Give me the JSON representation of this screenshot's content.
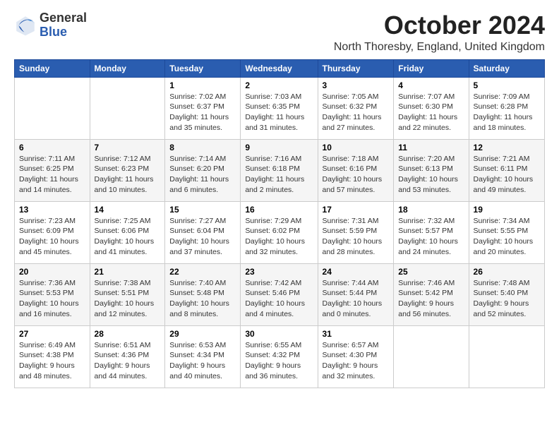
{
  "logo": {
    "general": "General",
    "blue": "Blue"
  },
  "title": "October 2024",
  "location": "North Thoresby, England, United Kingdom",
  "weekdays": [
    "Sunday",
    "Monday",
    "Tuesday",
    "Wednesday",
    "Thursday",
    "Friday",
    "Saturday"
  ],
  "weeks": [
    [
      {
        "day": "",
        "sunrise": "",
        "sunset": "",
        "daylight": ""
      },
      {
        "day": "",
        "sunrise": "",
        "sunset": "",
        "daylight": ""
      },
      {
        "day": "1",
        "sunrise": "Sunrise: 7:02 AM",
        "sunset": "Sunset: 6:37 PM",
        "daylight": "Daylight: 11 hours and 35 minutes."
      },
      {
        "day": "2",
        "sunrise": "Sunrise: 7:03 AM",
        "sunset": "Sunset: 6:35 PM",
        "daylight": "Daylight: 11 hours and 31 minutes."
      },
      {
        "day": "3",
        "sunrise": "Sunrise: 7:05 AM",
        "sunset": "Sunset: 6:32 PM",
        "daylight": "Daylight: 11 hours and 27 minutes."
      },
      {
        "day": "4",
        "sunrise": "Sunrise: 7:07 AM",
        "sunset": "Sunset: 6:30 PM",
        "daylight": "Daylight: 11 hours and 22 minutes."
      },
      {
        "day": "5",
        "sunrise": "Sunrise: 7:09 AM",
        "sunset": "Sunset: 6:28 PM",
        "daylight": "Daylight: 11 hours and 18 minutes."
      }
    ],
    [
      {
        "day": "6",
        "sunrise": "Sunrise: 7:11 AM",
        "sunset": "Sunset: 6:25 PM",
        "daylight": "Daylight: 11 hours and 14 minutes."
      },
      {
        "day": "7",
        "sunrise": "Sunrise: 7:12 AM",
        "sunset": "Sunset: 6:23 PM",
        "daylight": "Daylight: 11 hours and 10 minutes."
      },
      {
        "day": "8",
        "sunrise": "Sunrise: 7:14 AM",
        "sunset": "Sunset: 6:20 PM",
        "daylight": "Daylight: 11 hours and 6 minutes."
      },
      {
        "day": "9",
        "sunrise": "Sunrise: 7:16 AM",
        "sunset": "Sunset: 6:18 PM",
        "daylight": "Daylight: 11 hours and 2 minutes."
      },
      {
        "day": "10",
        "sunrise": "Sunrise: 7:18 AM",
        "sunset": "Sunset: 6:16 PM",
        "daylight": "Daylight: 10 hours and 57 minutes."
      },
      {
        "day": "11",
        "sunrise": "Sunrise: 7:20 AM",
        "sunset": "Sunset: 6:13 PM",
        "daylight": "Daylight: 10 hours and 53 minutes."
      },
      {
        "day": "12",
        "sunrise": "Sunrise: 7:21 AM",
        "sunset": "Sunset: 6:11 PM",
        "daylight": "Daylight: 10 hours and 49 minutes."
      }
    ],
    [
      {
        "day": "13",
        "sunrise": "Sunrise: 7:23 AM",
        "sunset": "Sunset: 6:09 PM",
        "daylight": "Daylight: 10 hours and 45 minutes."
      },
      {
        "day": "14",
        "sunrise": "Sunrise: 7:25 AM",
        "sunset": "Sunset: 6:06 PM",
        "daylight": "Daylight: 10 hours and 41 minutes."
      },
      {
        "day": "15",
        "sunrise": "Sunrise: 7:27 AM",
        "sunset": "Sunset: 6:04 PM",
        "daylight": "Daylight: 10 hours and 37 minutes."
      },
      {
        "day": "16",
        "sunrise": "Sunrise: 7:29 AM",
        "sunset": "Sunset: 6:02 PM",
        "daylight": "Daylight: 10 hours and 32 minutes."
      },
      {
        "day": "17",
        "sunrise": "Sunrise: 7:31 AM",
        "sunset": "Sunset: 5:59 PM",
        "daylight": "Daylight: 10 hours and 28 minutes."
      },
      {
        "day": "18",
        "sunrise": "Sunrise: 7:32 AM",
        "sunset": "Sunset: 5:57 PM",
        "daylight": "Daylight: 10 hours and 24 minutes."
      },
      {
        "day": "19",
        "sunrise": "Sunrise: 7:34 AM",
        "sunset": "Sunset: 5:55 PM",
        "daylight": "Daylight: 10 hours and 20 minutes."
      }
    ],
    [
      {
        "day": "20",
        "sunrise": "Sunrise: 7:36 AM",
        "sunset": "Sunset: 5:53 PM",
        "daylight": "Daylight: 10 hours and 16 minutes."
      },
      {
        "day": "21",
        "sunrise": "Sunrise: 7:38 AM",
        "sunset": "Sunset: 5:51 PM",
        "daylight": "Daylight: 10 hours and 12 minutes."
      },
      {
        "day": "22",
        "sunrise": "Sunrise: 7:40 AM",
        "sunset": "Sunset: 5:48 PM",
        "daylight": "Daylight: 10 hours and 8 minutes."
      },
      {
        "day": "23",
        "sunrise": "Sunrise: 7:42 AM",
        "sunset": "Sunset: 5:46 PM",
        "daylight": "Daylight: 10 hours and 4 minutes."
      },
      {
        "day": "24",
        "sunrise": "Sunrise: 7:44 AM",
        "sunset": "Sunset: 5:44 PM",
        "daylight": "Daylight: 10 hours and 0 minutes."
      },
      {
        "day": "25",
        "sunrise": "Sunrise: 7:46 AM",
        "sunset": "Sunset: 5:42 PM",
        "daylight": "Daylight: 9 hours and 56 minutes."
      },
      {
        "day": "26",
        "sunrise": "Sunrise: 7:48 AM",
        "sunset": "Sunset: 5:40 PM",
        "daylight": "Daylight: 9 hours and 52 minutes."
      }
    ],
    [
      {
        "day": "27",
        "sunrise": "Sunrise: 6:49 AM",
        "sunset": "Sunset: 4:38 PM",
        "daylight": "Daylight: 9 hours and 48 minutes."
      },
      {
        "day": "28",
        "sunrise": "Sunrise: 6:51 AM",
        "sunset": "Sunset: 4:36 PM",
        "daylight": "Daylight: 9 hours and 44 minutes."
      },
      {
        "day": "29",
        "sunrise": "Sunrise: 6:53 AM",
        "sunset": "Sunset: 4:34 PM",
        "daylight": "Daylight: 9 hours and 40 minutes."
      },
      {
        "day": "30",
        "sunrise": "Sunrise: 6:55 AM",
        "sunset": "Sunset: 4:32 PM",
        "daylight": "Daylight: 9 hours and 36 minutes."
      },
      {
        "day": "31",
        "sunrise": "Sunrise: 6:57 AM",
        "sunset": "Sunset: 4:30 PM",
        "daylight": "Daylight: 9 hours and 32 minutes."
      },
      {
        "day": "",
        "sunrise": "",
        "sunset": "",
        "daylight": ""
      },
      {
        "day": "",
        "sunrise": "",
        "sunset": "",
        "daylight": ""
      }
    ]
  ]
}
